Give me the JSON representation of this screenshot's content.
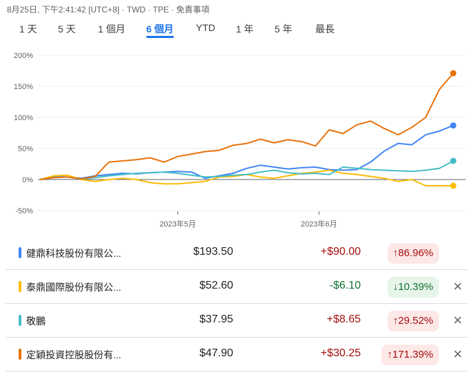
{
  "header": {
    "meta": "8月25日, 下午2:41:42 [UTC+8] · TWD · TPE · 免責事項"
  },
  "tabs": [
    {
      "label": "1 天"
    },
    {
      "label": "5 天"
    },
    {
      "label": "1 個月"
    },
    {
      "label": "6 個月",
      "active": true
    },
    {
      "label": "YTD"
    },
    {
      "label": "1 年"
    },
    {
      "label": "5 年"
    },
    {
      "label": "最長"
    }
  ],
  "chart_data": {
    "type": "line",
    "ylabel": "",
    "xlabel": "",
    "y_ticks": [
      "200%",
      "150%",
      "100%",
      "50%",
      "0%",
      "-50%"
    ],
    "y_tick_values": [
      200,
      150,
      100,
      50,
      0,
      -50
    ],
    "ylim": [
      -50,
      200
    ],
    "x_ticks": [
      {
        "label": "2023年5月",
        "index": 10
      },
      {
        "label": "2023年6月",
        "index": 20.25
      }
    ],
    "x_count": 31,
    "series": [
      {
        "name": "健鼎科技股份有限公...",
        "color": "#4285f4",
        "values": [
          0,
          5,
          4,
          2,
          6,
          8,
          10,
          9,
          11,
          12,
          13,
          12,
          2,
          6,
          10,
          18,
          23,
          20,
          17,
          19,
          20,
          16,
          15,
          16,
          28,
          46,
          58,
          56,
          72,
          78,
          87
        ]
      },
      {
        "name": "泰鼎國際股份有限公...",
        "color": "#fbbc04",
        "values": [
          0,
          6,
          7,
          0,
          -3,
          0,
          2,
          0,
          -5,
          -7,
          -7,
          -5,
          -3,
          4,
          5,
          8,
          4,
          2,
          6,
          10,
          12,
          15,
          10,
          8,
          5,
          2,
          -3,
          0,
          -10,
          -10,
          -10
        ]
      },
      {
        "name": "敬鵬",
        "color": "#46bdc6",
        "values": [
          0,
          3,
          4,
          1,
          3,
          6,
          8,
          10,
          11,
          12,
          10,
          7,
          4,
          5,
          7,
          8,
          12,
          15,
          11,
          9,
          10,
          8,
          20,
          18,
          16,
          15,
          14,
          13,
          15,
          18,
          30
        ]
      },
      {
        "name": "定穎投資控股股份有...",
        "color": "#e8710a",
        "values": [
          0,
          3,
          4,
          1,
          5,
          28,
          30,
          32,
          35,
          28,
          37,
          41,
          45,
          47,
          55,
          58,
          65,
          59,
          64,
          61,
          54,
          80,
          74,
          88,
          94,
          82,
          72,
          84,
          100,
          145,
          171
        ]
      }
    ]
  },
  "stocks": [
    {
      "name": "健鼎科技股份有限公...",
      "color": "#4285f4",
      "price": "$193.50",
      "change": "+$90.00",
      "percent": "86.96%",
      "dir": "up",
      "arrow": "↑",
      "removable": false
    },
    {
      "name": "泰鼎國際股份有限公...",
      "color": "#fbbc04",
      "price": "$52.60",
      "change": "-$6.10",
      "percent": "10.39%",
      "dir": "down",
      "arrow": "↓",
      "removable": true
    },
    {
      "name": "敬鵬",
      "color": "#46bdc6",
      "price": "$37.95",
      "change": "+$8.65",
      "percent": "29.52%",
      "dir": "up",
      "arrow": "↑",
      "removable": true
    },
    {
      "name": "定穎投資控股股份有...",
      "color": "#e8710a",
      "price": "$47.90",
      "change": "+$30.25",
      "percent": "171.39%",
      "dir": "up",
      "arrow": "↑",
      "removable": true
    }
  ],
  "icons": {
    "close": "×"
  }
}
